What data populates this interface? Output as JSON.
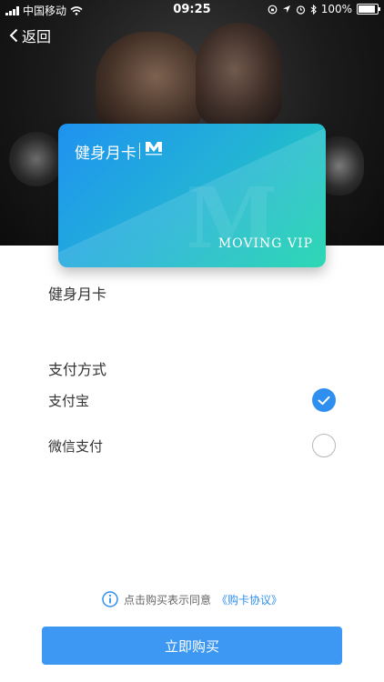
{
  "status_bar": {
    "carrier": "中国移动",
    "time": "09:25",
    "battery": "100%",
    "battery_level": 1.0
  },
  "nav": {
    "back_label": "返回"
  },
  "card": {
    "title": "健身月卡",
    "brand_text": "MOVING VIP"
  },
  "content": {
    "card_name": "健身月卡",
    "payment_section_title": "支付方式",
    "payment_methods": [
      {
        "label": "支付宝",
        "selected": true
      },
      {
        "label": "微信支付",
        "selected": false
      }
    ]
  },
  "footer": {
    "agreement_prefix": "点击购买表示同意",
    "agreement_link": "《购卡协议》",
    "buy_label": "立即购买"
  },
  "colors": {
    "accent": "#2e8ff0",
    "button": "#3c98f2"
  },
  "icons": {
    "back": "chevron-left-icon",
    "selected": "check-icon",
    "info": "info-icon"
  }
}
